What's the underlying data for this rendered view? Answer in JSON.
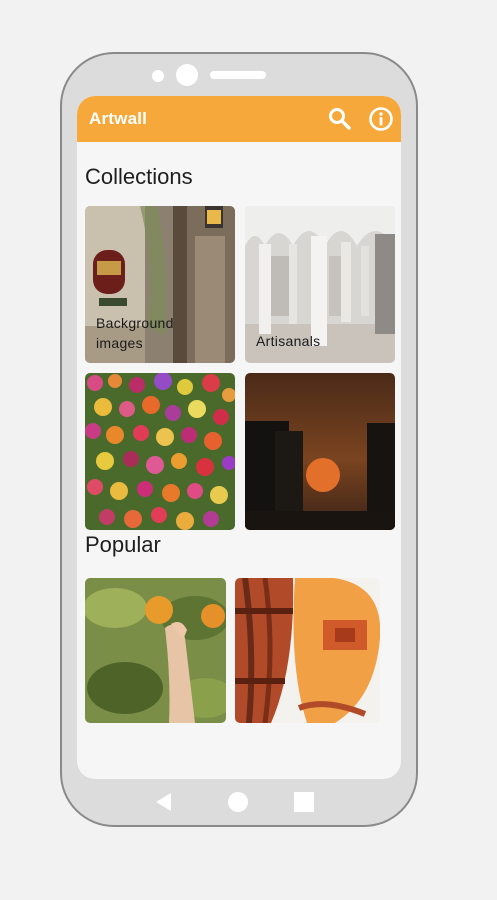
{
  "app": {
    "title": "Artwall"
  },
  "collections": {
    "title": "Collections",
    "items": [
      {
        "label": "Background images"
      },
      {
        "label": "Artisanals"
      },
      {
        "label": ""
      },
      {
        "label": ""
      }
    ]
  },
  "popular": {
    "title": "Popular"
  },
  "colors": {
    "accent": "#f6a83a",
    "frame": "#dcdcdc",
    "screen": "#f6f6f6"
  }
}
